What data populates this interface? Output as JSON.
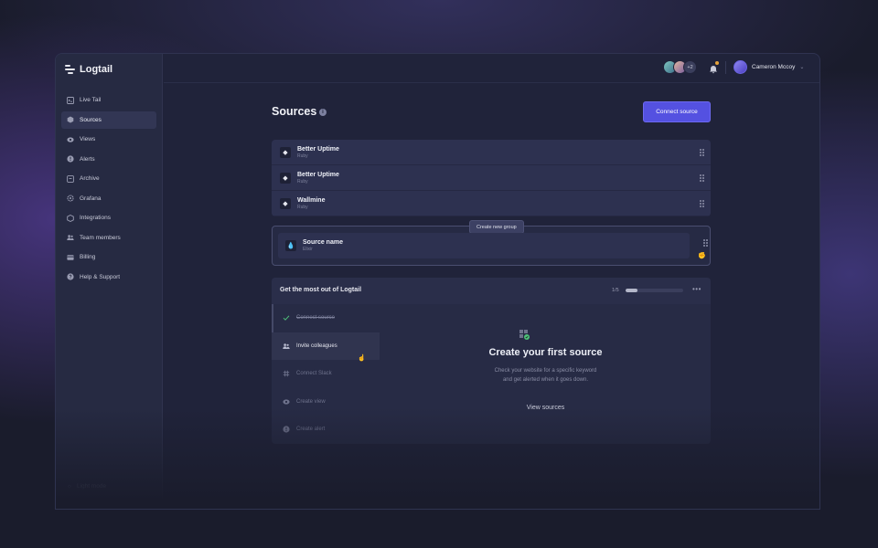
{
  "brand": {
    "name": "Logtail"
  },
  "sidebar": {
    "items": [
      {
        "label": "Live Tail",
        "icon": "terminal-icon"
      },
      {
        "label": "Sources",
        "icon": "cube-icon",
        "active": true
      },
      {
        "label": "Views",
        "icon": "eye-icon"
      },
      {
        "label": "Alerts",
        "icon": "alert-icon"
      },
      {
        "label": "Archive",
        "icon": "archive-icon"
      },
      {
        "label": "Grafana",
        "icon": "grafana-icon"
      },
      {
        "label": "Integrations",
        "icon": "puzzle-icon"
      },
      {
        "label": "Team members",
        "icon": "people-icon"
      },
      {
        "label": "Billing",
        "icon": "card-icon"
      },
      {
        "label": "Help & Support",
        "icon": "help-icon"
      }
    ],
    "light_mode": "Light mode"
  },
  "topbar": {
    "extra_members": "+2",
    "user_name": "Cameron Mccoy"
  },
  "main": {
    "title": "Sources",
    "connect_button": "Connect source",
    "sources": [
      {
        "name": "Better Uptime",
        "platform": "Ruby"
      },
      {
        "name": "Better Uptime",
        "platform": "Ruby"
      },
      {
        "name": "Wallmine",
        "platform": "Ruby"
      }
    ],
    "group": {
      "tooltip": "Create new group",
      "source_name": "Source name",
      "source_platform": "Elixir"
    },
    "onboarding": {
      "title": "Get the most out of Logtail",
      "progress_text": "1/5",
      "progress": 0.2,
      "steps": [
        {
          "label": "Connect source",
          "state": "done"
        },
        {
          "label": "Invite colleagues",
          "state": "active"
        },
        {
          "label": "Connect Slack",
          "state": "todo"
        },
        {
          "label": "Create view",
          "state": "todo"
        },
        {
          "label": "Create alert",
          "state": "todo"
        }
      ],
      "cta_title": "Create your first source",
      "cta_desc_1": "Check your website for a specific keyword",
      "cta_desc_2": "and get alerted when it goes down.",
      "cta_link": "View sources"
    }
  },
  "colors": {
    "accent": "#5451e1",
    "success": "#4fc27a",
    "notification": "#e4a23a"
  }
}
